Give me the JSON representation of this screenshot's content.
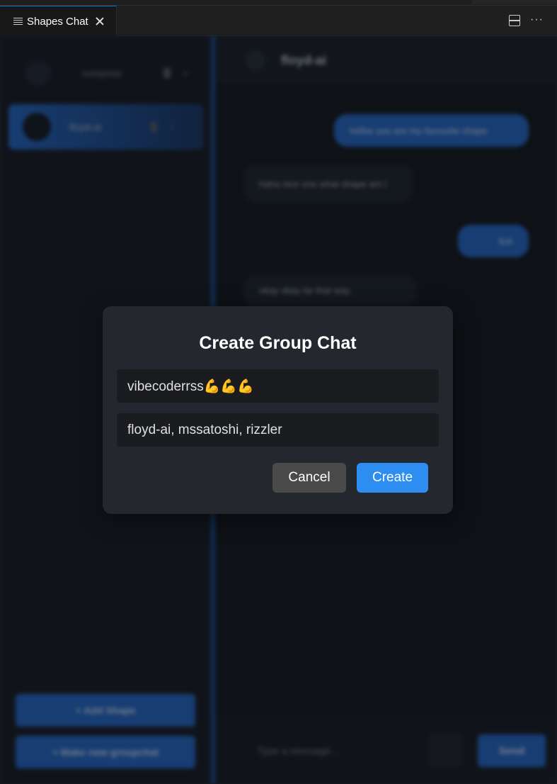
{
  "tab": {
    "label": "Shapes Chat",
    "icon": "list-icon",
    "close_icon": "close-icon"
  },
  "toolbar": {
    "split_icon": "split-editor-icon",
    "more_icon": "ellipsis-icon",
    "more_glyph": "···"
  },
  "sidebar": {
    "shapes": [
      {
        "name": "icespose"
      },
      {
        "name": "floyd-ai"
      }
    ],
    "add_shape_label": "+ Add Shape",
    "new_group_label": "+ Make new groupchat"
  },
  "chat": {
    "title": "floyd-ai",
    "messages": [
      {
        "role": "user",
        "text": "hellos you are my favourite shape"
      },
      {
        "role": "bot",
        "text": "haha nice one what shape am i"
      },
      {
        "role": "user",
        "text": "lluh"
      },
      {
        "role": "bot",
        "text": "okay okay be that way"
      }
    ],
    "input_placeholder": "Type a message...",
    "send_label": "Send"
  },
  "modal": {
    "title": "Create Group Chat",
    "name_value": "vibecoderrss💪💪💪",
    "members_value": "floyd-ai, mssatoshi, rizzler",
    "cancel_label": "Cancel",
    "create_label": "Create"
  },
  "colors": {
    "accent": "#2e8df0",
    "modal_bg": "#24282e",
    "field_bg": "#1a1c1f",
    "cancel_bg": "#4a4a4a"
  }
}
